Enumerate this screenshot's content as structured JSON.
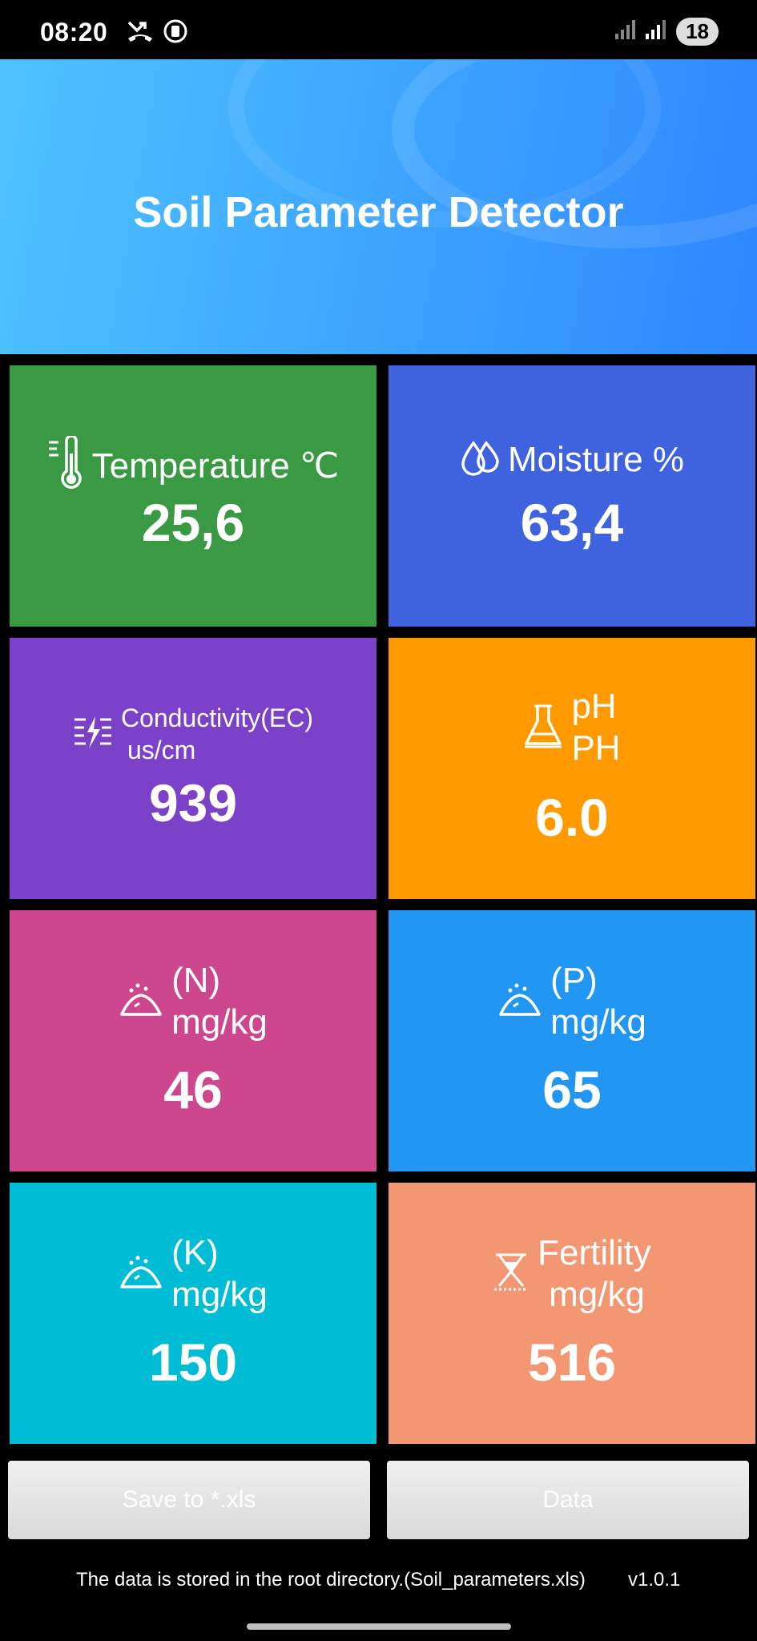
{
  "status": {
    "time": "08:20",
    "battery": "18",
    "icons_left": [
      "missed-call-icon",
      "screen-record-icon"
    ],
    "icons_right": [
      "signal-1-icon",
      "signal-2-icon",
      "battery-icon"
    ]
  },
  "header": {
    "title": "Soil Parameter Detector"
  },
  "tiles": {
    "temperature": {
      "label": "Temperature ℃",
      "value": "25,6",
      "icon": "thermometer-icon",
      "color": "#3a9a44"
    },
    "moisture": {
      "label": "Moisture %",
      "value": "63,4",
      "icon": "water-drops-icon",
      "color": "#3f63de"
    },
    "conductivity": {
      "label_line1": "Conductivity(EC)",
      "label_line2": "us/cm",
      "value": "939",
      "icon": "conductivity-icon",
      "color": "#7b41c9"
    },
    "ph": {
      "label_line1": "pH",
      "label_line2": "PH",
      "value": "6.0",
      "icon": "flask-icon",
      "color": "#ff9900"
    },
    "nitrogen": {
      "label_line1": "(N)",
      "label_line2": "mg/kg",
      "value": "46",
      "icon": "fertilizer-pile-icon",
      "color": "#cd478e"
    },
    "phosphorus": {
      "label_line1": "(P)",
      "label_line2": "mg/kg",
      "value": "65",
      "icon": "fertilizer-pile-icon",
      "color": "#2196f3"
    },
    "potassium": {
      "label_line1": "(K)",
      "label_line2": "mg/kg",
      "value": "150",
      "icon": "fertilizer-pile-icon",
      "color": "#00bcd4"
    },
    "fertility": {
      "label_line1": "Fertility",
      "label_line2": "mg/kg",
      "value": "516",
      "icon": "hourglass-icon",
      "color": "#f29771"
    }
  },
  "buttons": {
    "save_label": "Save to *.xls",
    "data_label": "Data"
  },
  "footer": {
    "note": "The data is stored in the root directory.(Soil_parameters.xls)",
    "version": "v1.0.1"
  }
}
